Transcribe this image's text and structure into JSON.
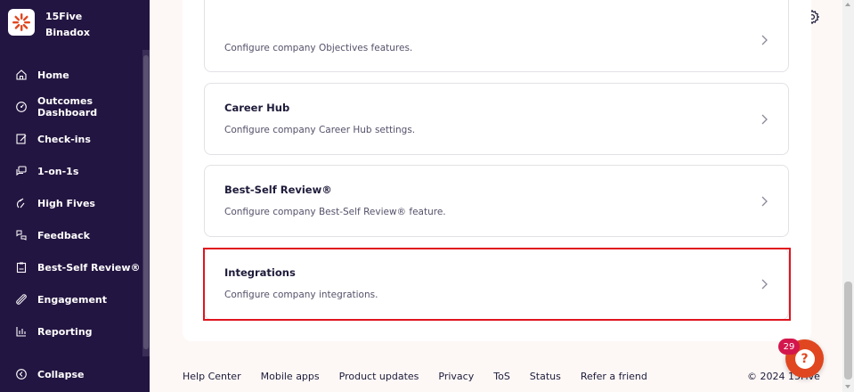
{
  "brand": {
    "name": "15Five",
    "company": "Binadox"
  },
  "sidebar": {
    "items": [
      {
        "label": "Home",
        "icon": "home-icon"
      },
      {
        "label": "Outcomes Dashboard",
        "icon": "dashboard-icon"
      },
      {
        "label": "Check-ins",
        "icon": "checkin-icon"
      },
      {
        "label": "1-on-1s",
        "icon": "chat-icon"
      },
      {
        "label": "High Fives",
        "icon": "high-five-icon"
      },
      {
        "label": "Feedback",
        "icon": "feedback-icon"
      },
      {
        "label": "Best-Self Review®",
        "icon": "clipboard-icon"
      },
      {
        "label": "Engagement",
        "icon": "engagement-icon"
      },
      {
        "label": "Reporting",
        "icon": "chart-icon"
      }
    ],
    "collapse_label": "Collapse"
  },
  "cards": [
    {
      "title": "",
      "description": "Configure company Objectives features."
    },
    {
      "title": "Career Hub",
      "description": "Configure company Career Hub settings."
    },
    {
      "title": "Best-Self Review®",
      "description": "Configure company Best-Self Review® feature."
    },
    {
      "title": "Integrations",
      "description": "Configure company integrations."
    }
  ],
  "footer": {
    "links": [
      "Help Center",
      "Mobile apps",
      "Product updates",
      "Privacy",
      "ToS",
      "Status",
      "Refer a friend"
    ],
    "copyright": "© 2024 15Five"
  },
  "help": {
    "badge_count": "29",
    "glyph": "?"
  },
  "colors": {
    "sidebar_bg": "#231541",
    "accent": "#e0461f",
    "highlight": "#e0141e",
    "badge": "#d3174c"
  }
}
